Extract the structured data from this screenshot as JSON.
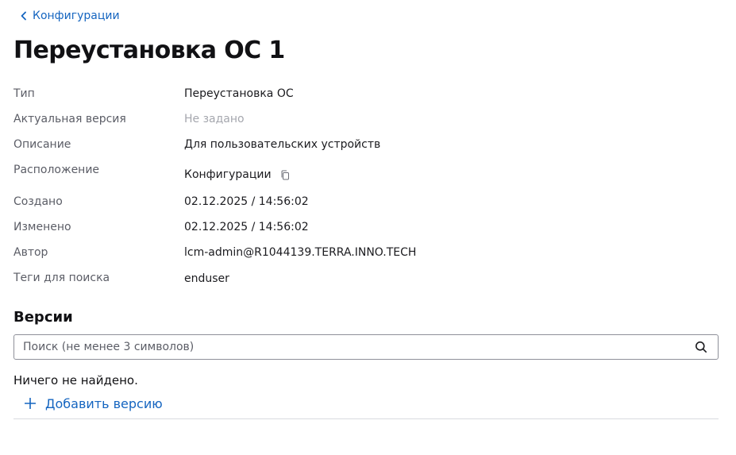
{
  "header": {
    "back_label": "Конфигурации",
    "title": "Переустановка ОС 1"
  },
  "properties": [
    {
      "label": "Тип",
      "value": "Переустановка ОС"
    },
    {
      "label": "Актуальная версия",
      "value": "Не задано"
    },
    {
      "label": "Описание",
      "value": "Для пользовательских устройств"
    },
    {
      "label": "Расположение",
      "value": "Конфигурации"
    },
    {
      "label": "Создано",
      "value": "02.12.2025 / 14:56:02"
    },
    {
      "label": "Изменено",
      "value": "02.12.2025 / 14:56:02"
    },
    {
      "label": "Автор",
      "value": "lcm-admin@R1044139.TERRA.INNO.TECH"
    },
    {
      "label": "Теги для поиска",
      "value": "enduser"
    }
  ],
  "versions": {
    "title": "Версии",
    "search": {
      "placeholder": "Поиск (не менее 3 символов)",
      "value": ""
    },
    "empty_text": "Ничего не найдено.",
    "add_label": "Добавить версию"
  },
  "colors": {
    "accent": "#1565c0",
    "muted_text": "#a5a7ae",
    "label_text": "#5b5d66"
  },
  "icons": {
    "back": "chevron-left-icon",
    "copy": "copy-icon",
    "search": "search-icon",
    "add": "plus-icon"
  }
}
